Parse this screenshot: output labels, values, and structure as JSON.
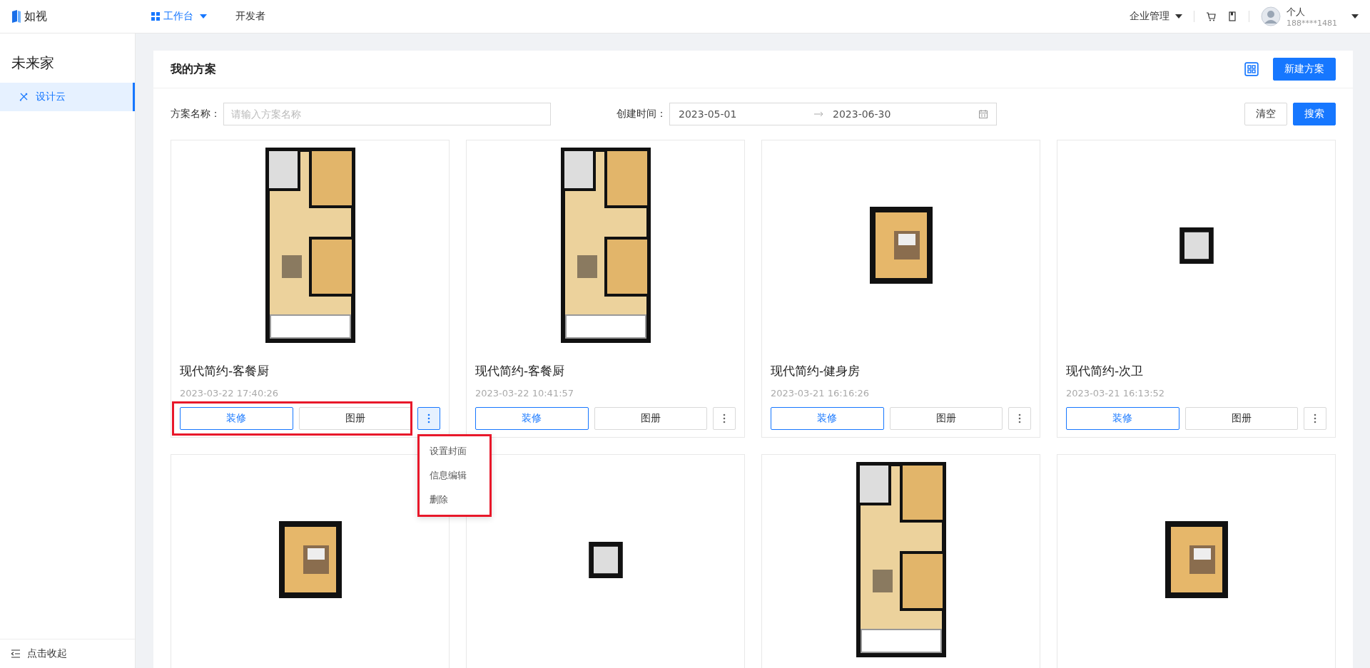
{
  "topbar": {
    "brand": "如视",
    "nav": [
      {
        "label": "工作台",
        "selected": true,
        "dropdown": true
      },
      {
        "label": "开发者",
        "selected": false,
        "dropdown": false
      }
    ],
    "org_menu": "企业管理",
    "user": {
      "name": "个人",
      "phone": "188****1481"
    }
  },
  "sidebar": {
    "title": "未来家",
    "items": [
      {
        "label": "设计云",
        "selected": true
      }
    ],
    "collapse": "点击收起"
  },
  "page": {
    "title": "我的方案",
    "new_button": "新建方案"
  },
  "filters": {
    "name_label": "方案名称：",
    "name_placeholder": "请输入方案名称",
    "date_label": "创建时间：",
    "start": "2023-05-01",
    "end": "2023-06-30",
    "clear": "清空",
    "search": "搜索"
  },
  "cards": [
    {
      "kind": "apartment",
      "title": "现代简约-客餐厨",
      "date": "2023-03-22 17:40:26",
      "decorate": "装修",
      "album": "图册",
      "highlighted": true,
      "menu_open": true
    },
    {
      "kind": "apartment",
      "title": "现代简约-客餐厨",
      "date": "2023-03-22 10:41:57",
      "decorate": "装修",
      "album": "图册",
      "highlighted": false,
      "menu_open": false
    },
    {
      "kind": "bedroom",
      "title": "现代简约-健身房",
      "date": "2023-03-21 16:16:26",
      "decorate": "装修",
      "album": "图册",
      "highlighted": false,
      "menu_open": false
    },
    {
      "kind": "bathroom",
      "title": "现代简约-次卫",
      "date": "2023-03-21 16:13:52",
      "decorate": "装修",
      "album": "图册",
      "highlighted": false,
      "menu_open": false
    },
    {
      "kind": "bedroom"
    },
    {
      "kind": "bathroom"
    },
    {
      "kind": "apartment"
    },
    {
      "kind": "bedroom"
    }
  ],
  "menu": {
    "items": [
      "设置封面",
      "信息编辑",
      "删除"
    ]
  }
}
